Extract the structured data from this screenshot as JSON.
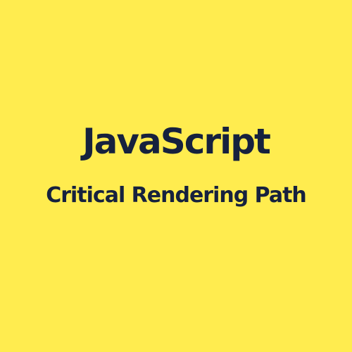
{
  "title": "JavaScript",
  "subtitle": "Critical Rendering Path",
  "colors": {
    "background": "#FFEC4F",
    "text": "#16213E"
  }
}
